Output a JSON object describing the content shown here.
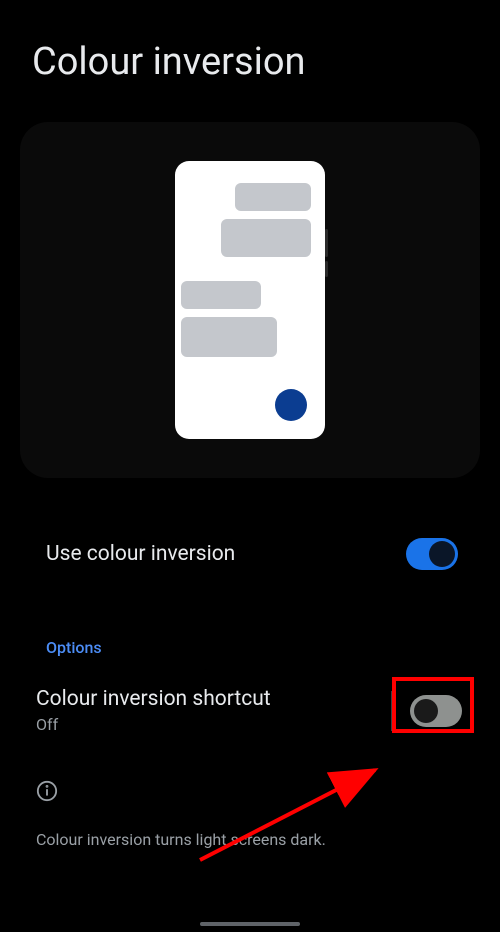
{
  "header": {
    "title": "Colour inversion"
  },
  "settings": {
    "use_inversion_label": "Use colour inversion",
    "use_inversion_on": true
  },
  "options": {
    "section_label": "Options",
    "shortcut_label": "Colour inversion shortcut",
    "shortcut_status": "Off",
    "shortcut_on": false
  },
  "info": {
    "text": "Colour inversion turns light screens dark."
  }
}
